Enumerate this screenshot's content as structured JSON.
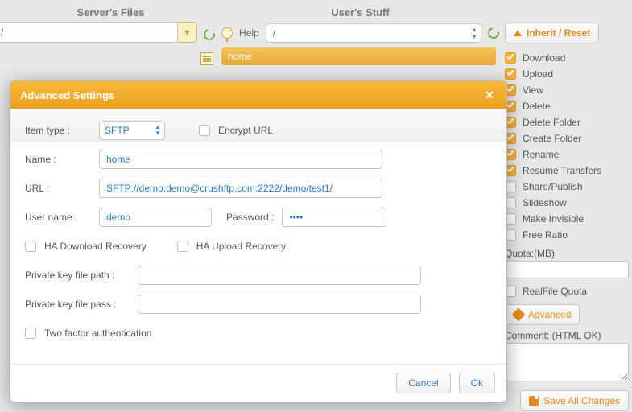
{
  "headings": {
    "server_files": "Server's Files",
    "user_stuff": "User's Stuff"
  },
  "combo1_value": "/",
  "help_label": "Help",
  "path_value": "/",
  "home_bar": "home",
  "side": {
    "inherit_reset": "Inherit / Reset",
    "perms": [
      {
        "label": "Download",
        "on": true
      },
      {
        "label": "Upload",
        "on": true
      },
      {
        "label": "View",
        "on": true
      },
      {
        "label": "Delete",
        "on": true
      },
      {
        "label": "Delete Folder",
        "on": true
      },
      {
        "label": "Create Folder",
        "on": true
      },
      {
        "label": "Rename",
        "on": true
      },
      {
        "label": "Resume Transfers",
        "on": true
      },
      {
        "label": "Share/Publish",
        "on": false
      },
      {
        "label": "Slideshow",
        "on": false
      },
      {
        "label": "Make Invisible",
        "on": false
      },
      {
        "label": "Free Ratio",
        "on": false
      }
    ],
    "quota_label": "Quota:(MB)",
    "realfile_quota": "RealFile Quota",
    "advanced": "Advanced",
    "comment_label": "Comment: (HTML OK)",
    "save": "Save All Changes"
  },
  "modal": {
    "title": "Advanced Settings",
    "item_type_label": "Item type :",
    "item_type_value": "SFTP",
    "encrypt_url": "Encrypt URL",
    "name_label": "Name :",
    "name_value": "home",
    "url_label": "URL :",
    "url_value": "SFTP://demo:demo@crushftp.com:2222/demo/test1/",
    "username_label": "User name :",
    "username_value": "demo",
    "password_label": "Password :",
    "password_value": "••••",
    "ha_download": "HA Download Recovery",
    "ha_upload": "HA Upload Recovery",
    "pk_path_label": "Private key file path :",
    "pk_path_value": "",
    "pk_pass_label": "Private key file pass :",
    "pk_pass_value": "",
    "two_factor": "Two factor authentication",
    "cancel": "Cancel",
    "ok": "Ok"
  }
}
